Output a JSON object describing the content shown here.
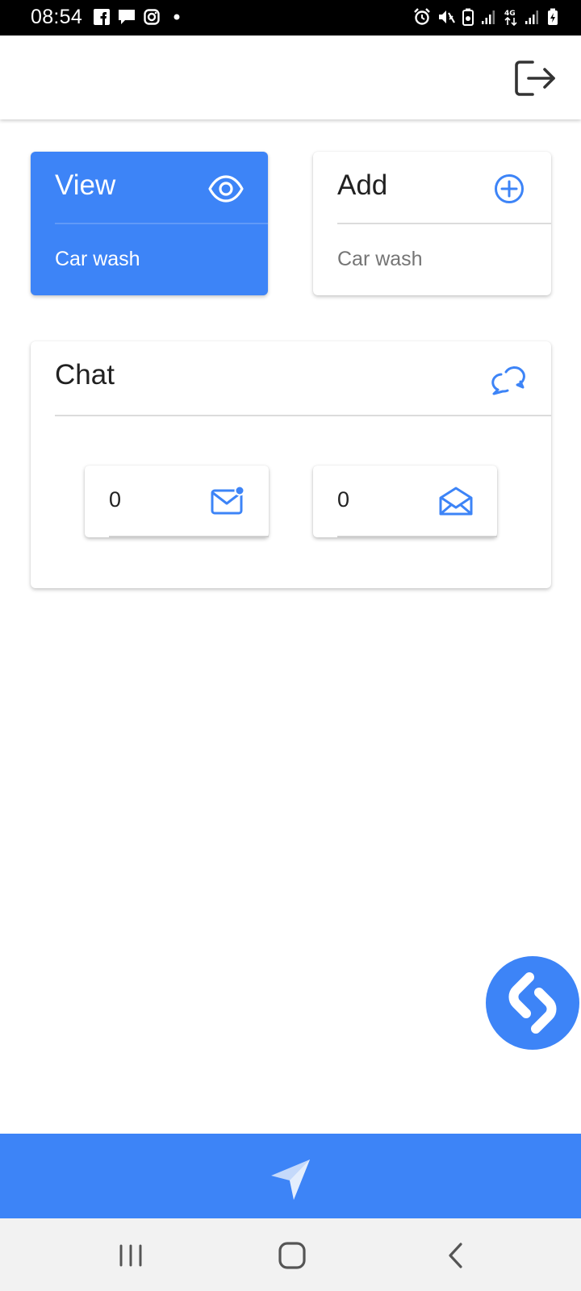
{
  "status_bar": {
    "time": "08:54",
    "left_icons": [
      "facebook-icon",
      "message-icon",
      "instagram-icon",
      "dot-icon"
    ],
    "right_icons": [
      "alarm-icon",
      "mute-icon",
      "battery-saver-icon",
      "signal-icon",
      "4g-icon",
      "signal-icon",
      "battery-icon"
    ]
  },
  "app_bar": {
    "logout_icon": "logout-icon"
  },
  "cards": {
    "view": {
      "title": "View",
      "subtitle": "Car wash",
      "icon": "eye-icon"
    },
    "add": {
      "title": "Add",
      "subtitle": "Car wash",
      "icon": "plus-circle-icon"
    }
  },
  "chat": {
    "title": "Chat",
    "icon": "chat-bubbles-icon",
    "unread": {
      "count": "0",
      "icon": "mail-unread-icon"
    },
    "read": {
      "count": "0",
      "icon": "mail-open-icon"
    }
  },
  "colors": {
    "accent": "#3d84f7",
    "text_dark": "#212121",
    "text_muted": "#757575"
  },
  "bottom_bar": {
    "icon": "navigation-arrow-icon"
  },
  "floating": {
    "icon": "shazam-icon"
  },
  "system_nav": {
    "recent": "recent-apps-icon",
    "home": "home-icon",
    "back": "back-icon"
  }
}
